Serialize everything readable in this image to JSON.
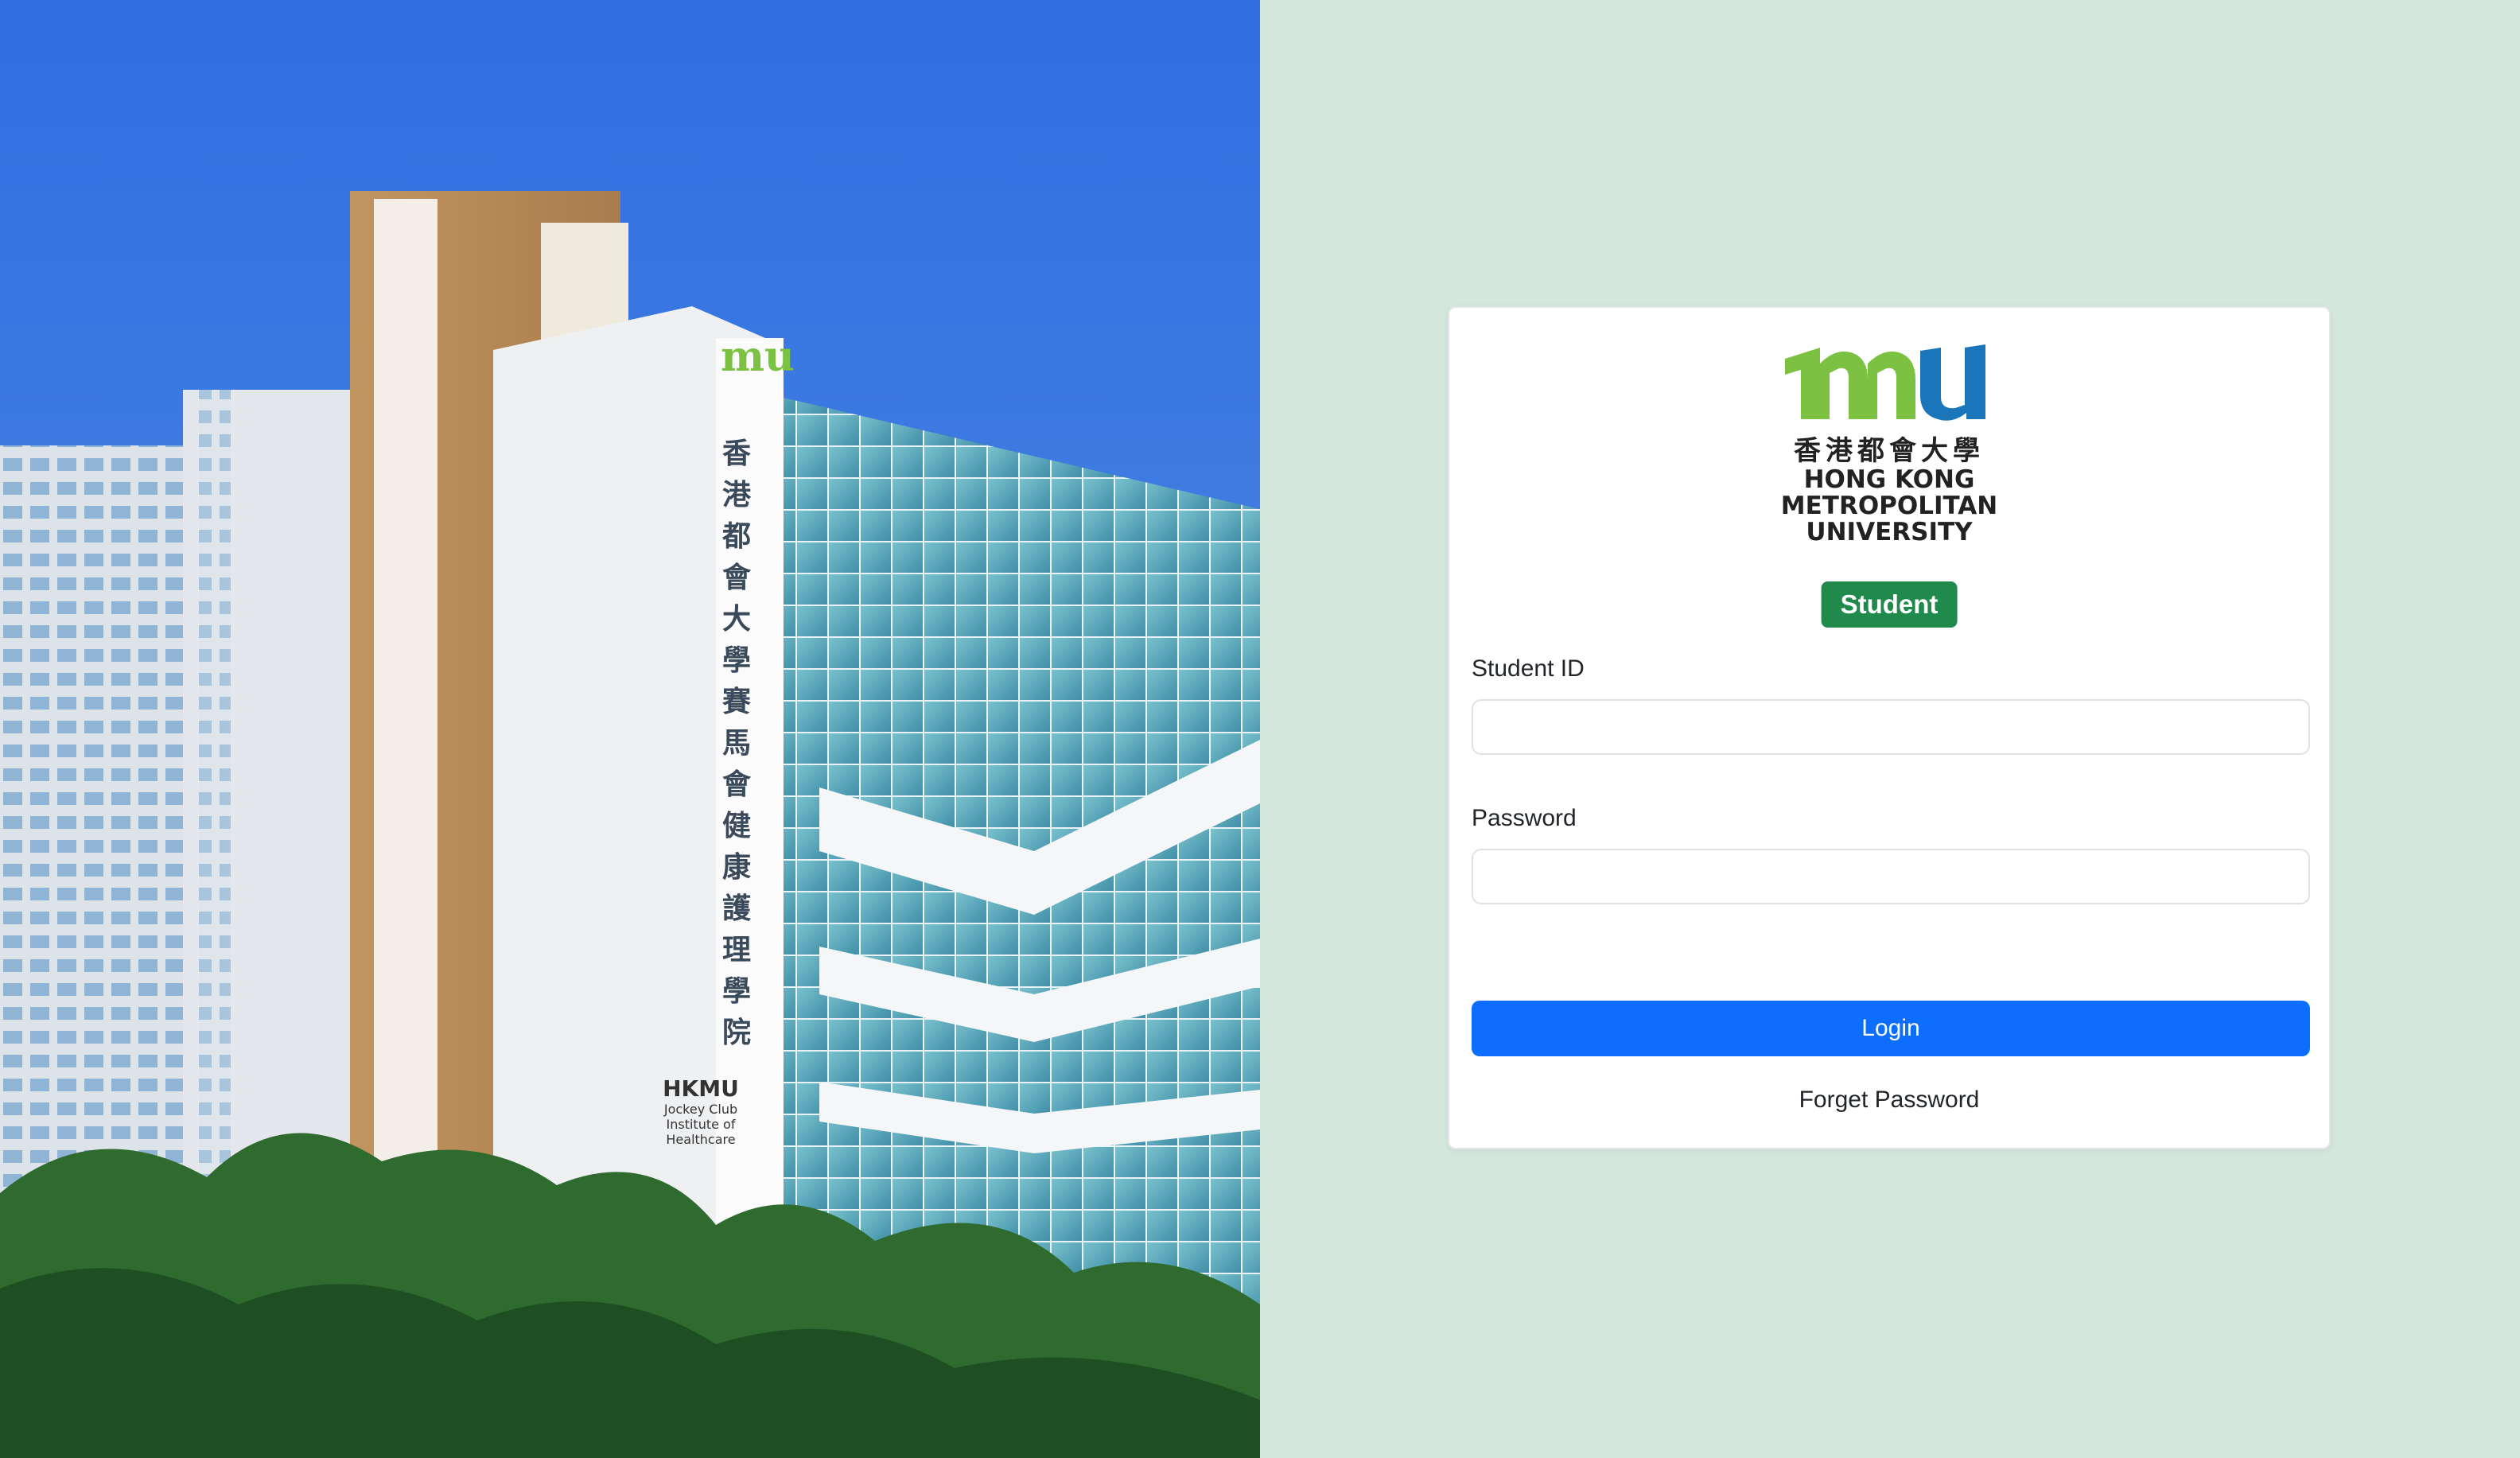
{
  "hero": {
    "sign_logo": "mu",
    "sign_chinese": "香港都會大學賽馬會健康護理學院",
    "sign_english_short": "HKMU",
    "sign_english_line1": "Jockey Club",
    "sign_english_line2": "Institute of",
    "sign_english_line3": "Healthcare"
  },
  "logo": {
    "mark": "mu",
    "chinese": "香港都會大學",
    "english_line1": "HONG KONG",
    "english_line2": "METROPOLITAN",
    "english_line3": "UNIVERSITY"
  },
  "role_badge": "Student",
  "form": {
    "student_id_label": "Student ID",
    "student_id_value": "",
    "password_label": "Password",
    "password_value": "",
    "login_label": "Login",
    "forget_label": "Forget Password"
  },
  "colors": {
    "panel_bg": "#d3e7dd",
    "badge_green": "#1f8a4c",
    "login_blue": "#0d6efd",
    "logo_green": "#7cc142",
    "logo_blue": "#1b75bb"
  }
}
